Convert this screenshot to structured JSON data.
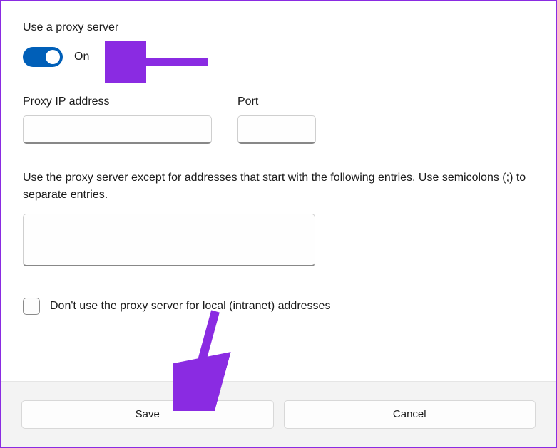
{
  "proxy": {
    "title": "Use a proxy server",
    "toggle_state": "On",
    "ip_label": "Proxy IP address",
    "ip_value": "",
    "port_label": "Port",
    "port_value": "",
    "exception_label": "Use the proxy server except for addresses that start with the following entries. Use semicolons (;) to separate entries.",
    "exception_value": "",
    "local_checkbox_label": "Don't use the proxy server for local (intranet) addresses",
    "local_checked": false
  },
  "buttons": {
    "save_label": "Save",
    "cancel_label": "Cancel"
  }
}
